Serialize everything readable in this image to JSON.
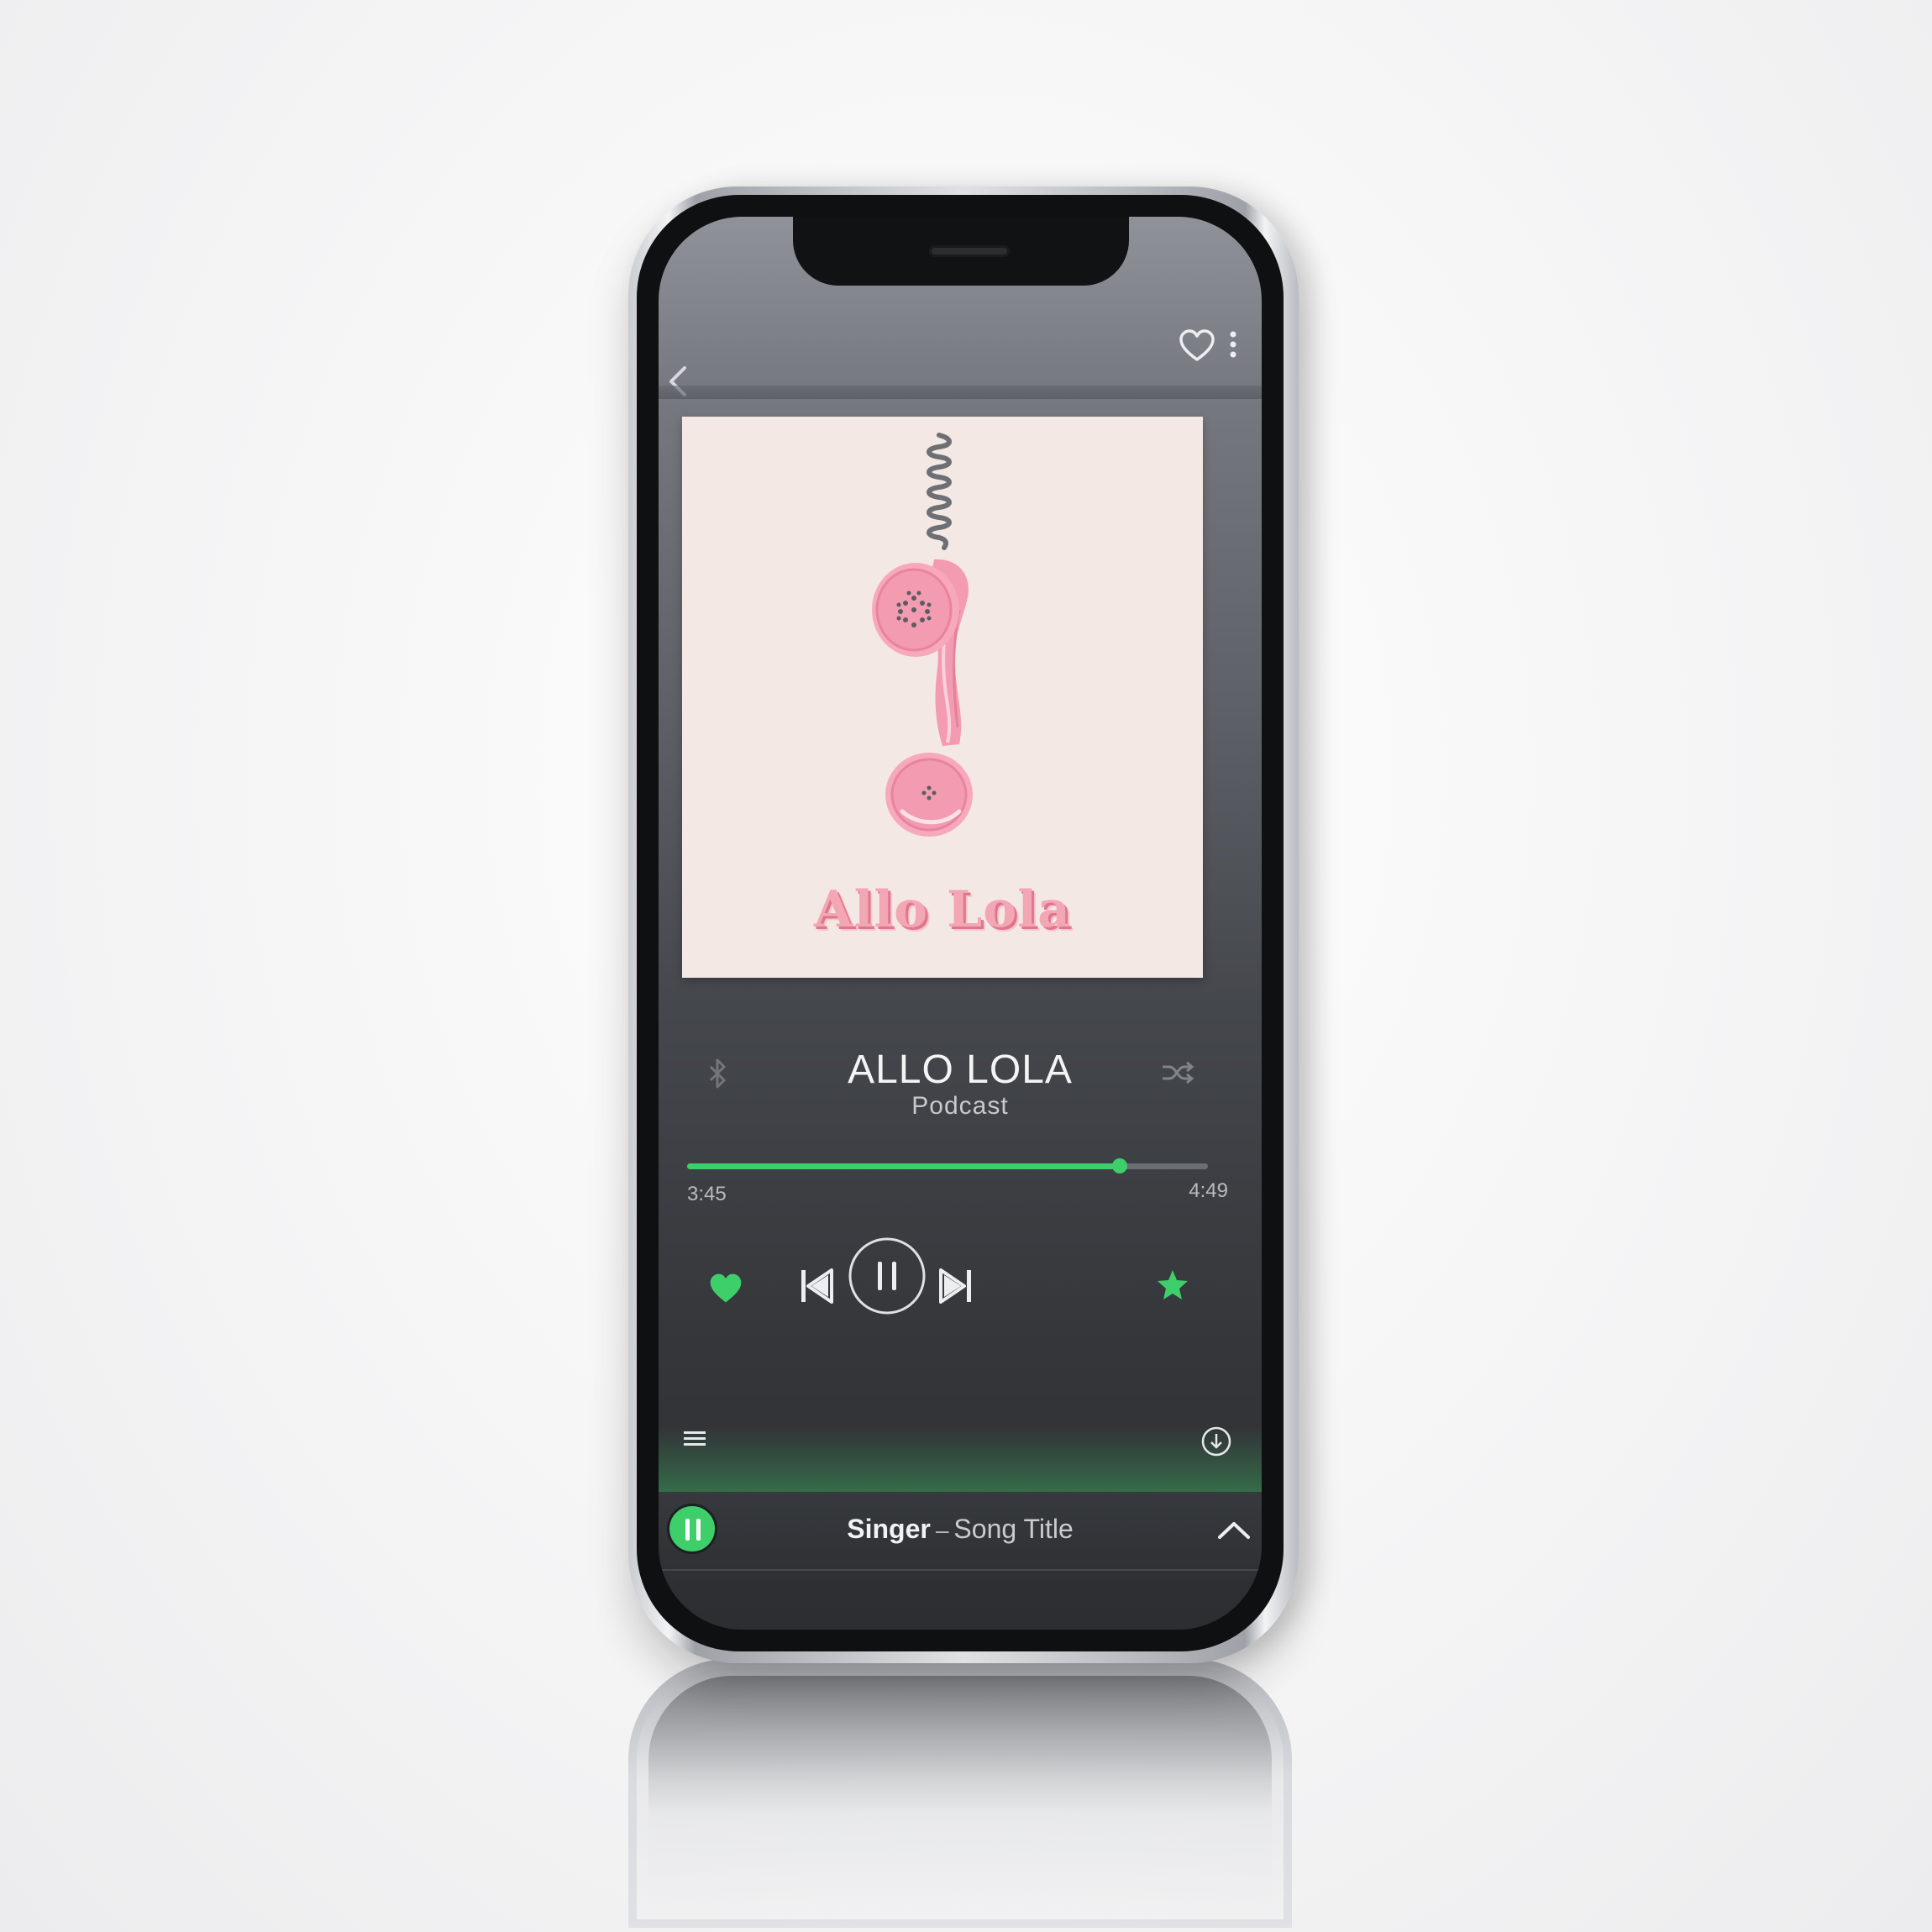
{
  "header": {
    "back_icon": "chevron-left-icon",
    "favorite_icon": "heart-outline-icon",
    "more_icon": "more-vertical-icon"
  },
  "cover": {
    "title": "Allo Lola",
    "colors": {
      "background": "#f4e8e4",
      "handset": "#f39bb0",
      "cord": "#6d6f75"
    }
  },
  "now_playing": {
    "title": "ALLO LOLA",
    "subtitle": "Podcast"
  },
  "progress": {
    "elapsed": "3:45",
    "total": "4:49",
    "fraction": 0.83
  },
  "controls": {
    "like_icon": "heart-filled-icon",
    "previous_icon": "skip-previous-icon",
    "play_pause_icon": "pause-icon",
    "next_icon": "skip-next-icon",
    "favorite_icon": "star-filled-icon",
    "bluetooth_icon": "bluetooth-icon",
    "shuffle_icon": "shuffle-icon",
    "queue_icon": "queue-list-icon",
    "download_icon": "download-icon"
  },
  "mini_player": {
    "singer": "Singer",
    "separator": "–",
    "song_title": "Song Title",
    "play_pause_icon": "pause-icon",
    "expand_icon": "chevron-up-icon"
  },
  "colors": {
    "accent": "#3fcf6a",
    "text_primary": "#f3f4f5",
    "text_secondary": "#c7c9cc"
  }
}
